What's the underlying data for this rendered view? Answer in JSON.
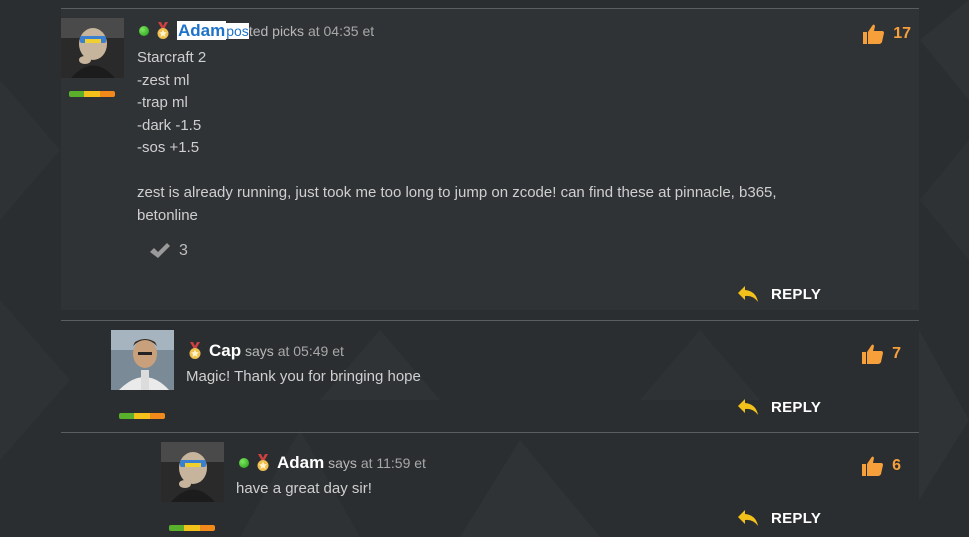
{
  "theme": {
    "accent_like": "#f6a03c",
    "link_blue": "#1e73c8",
    "online_green": "#3cc61f"
  },
  "comments": [
    {
      "user": "Adam",
      "user_selected": true,
      "selection_suffix": "pos",
      "action_rest": "ted picks",
      "time": "at 04:35 et",
      "online": true,
      "likes": "17",
      "lines": [
        "Starcraft 2",
        "-zest ml",
        "-trap ml",
        "-dark -1.5",
        "-sos +1.5",
        "",
        "zest is already running, just took me too long to jump on zcode! can find these at pinnacle, b365,",
        "betonline"
      ],
      "agree_count": "3",
      "reply_label": "REPLY",
      "icons": {
        "status": "online-dot-icon",
        "badge": "medal-icon",
        "like": "thumbs-up-icon",
        "agree": "check-icon",
        "reply": "reply-arrow-icon"
      }
    },
    {
      "user": "Cap",
      "action": "says",
      "time": "at 05:49 et",
      "online": false,
      "likes": "7",
      "text": "Magic! Thank you for bringing hope",
      "reply_label": "REPLY"
    },
    {
      "user": "Adam",
      "action": "says",
      "time": "at 11:59 et",
      "online": true,
      "likes": "6",
      "text": "have a great day sir!",
      "reply_label": "REPLY"
    }
  ]
}
